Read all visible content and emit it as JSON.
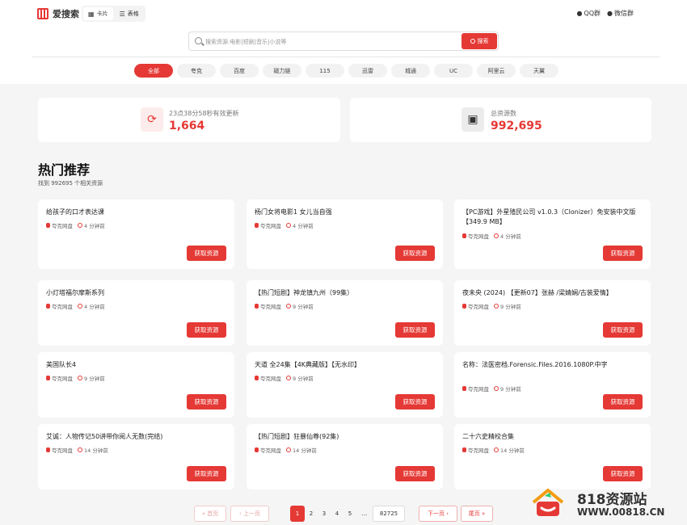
{
  "header": {
    "logo_text": "爱搜索",
    "view_options": [
      {
        "icon": "grid-icon",
        "label": "卡片"
      },
      {
        "icon": "list-icon",
        "label": "表格"
      }
    ],
    "qq_group": "QQ群",
    "wechat_group": "微信群"
  },
  "search": {
    "placeholder": "搜索资源:电影|短剧|音乐|小说等",
    "value": "",
    "button_label": "搜索"
  },
  "filters": [
    "全部",
    "夸克",
    "百度",
    "磁力链",
    "115",
    "迅雷",
    "城通",
    "UC",
    "阿里云",
    "天翼"
  ],
  "stats": {
    "updated": {
      "label": "23点38分58秒有效更新",
      "value": "1,664",
      "icon": "refresh-icon"
    },
    "total": {
      "label": "总资源数",
      "value": "992,695",
      "icon": "film-icon"
    }
  },
  "hot": {
    "title": "热门推荐",
    "count_text": "找到 992695 个相关资源"
  },
  "resources": [
    {
      "title": "给孩子的口才表达课",
      "source": "夸克网盘",
      "time": "4 分钟前"
    },
    {
      "title": "杨门女将电影1 女儿当自强",
      "source": "夸克网盘",
      "time": "4 分钟前"
    },
    {
      "title": "【PC游戏】外星殖民公司 v1.0.3（Clonizer）免安装中文版【349.9 MB】",
      "source": "夸克网盘",
      "time": "4 分钟前"
    },
    {
      "title": "小灯塔福尔摩斯系列",
      "source": "夸克网盘",
      "time": "4 分钟前"
    },
    {
      "title": "【热门短剧】神龙镇九州（99集）",
      "source": "夸克网盘",
      "time": "9 分钟前"
    },
    {
      "title": "夜未央 (2024) 【更新07】张赫 /梁婧娴/古装爱情】",
      "source": "夸克网盘",
      "time": "9 分钟前"
    },
    {
      "title": "美国队长4",
      "source": "夸克网盘",
      "time": "9 分钟前"
    },
    {
      "title": "天道 全24集【4K典藏版】【无水印】",
      "source": "夸克网盘",
      "time": "9 分钟前"
    },
    {
      "title": "名称：法医密档.Forensic.Files.2016.1080P.中字",
      "source": "夸克网盘",
      "time": "9 分钟前"
    },
    {
      "title": "艾诚：人物传记50讲带你阅人无数(完结)",
      "source": "夸克网盘",
      "time": "14 分钟前"
    },
    {
      "title": "【热门短剧】狂暴仙尊(92集)",
      "source": "夸克网盘",
      "time": "14 分钟前"
    },
    {
      "title": "二十六史精校合集",
      "source": "夸克网盘",
      "time": "14 分钟前"
    }
  ],
  "get_button_label": "获取资源",
  "pagination": {
    "first": "« 首页",
    "prev": "‹ 上一页",
    "pages": [
      "1",
      "2",
      "3",
      "4",
      "5"
    ],
    "ellipsis": "...",
    "last_page": "82725",
    "next": "下一页 ›",
    "last": "尾页 »"
  },
  "watermark": {
    "name": "818资源站",
    "url": "WWW.00818.CN"
  }
}
